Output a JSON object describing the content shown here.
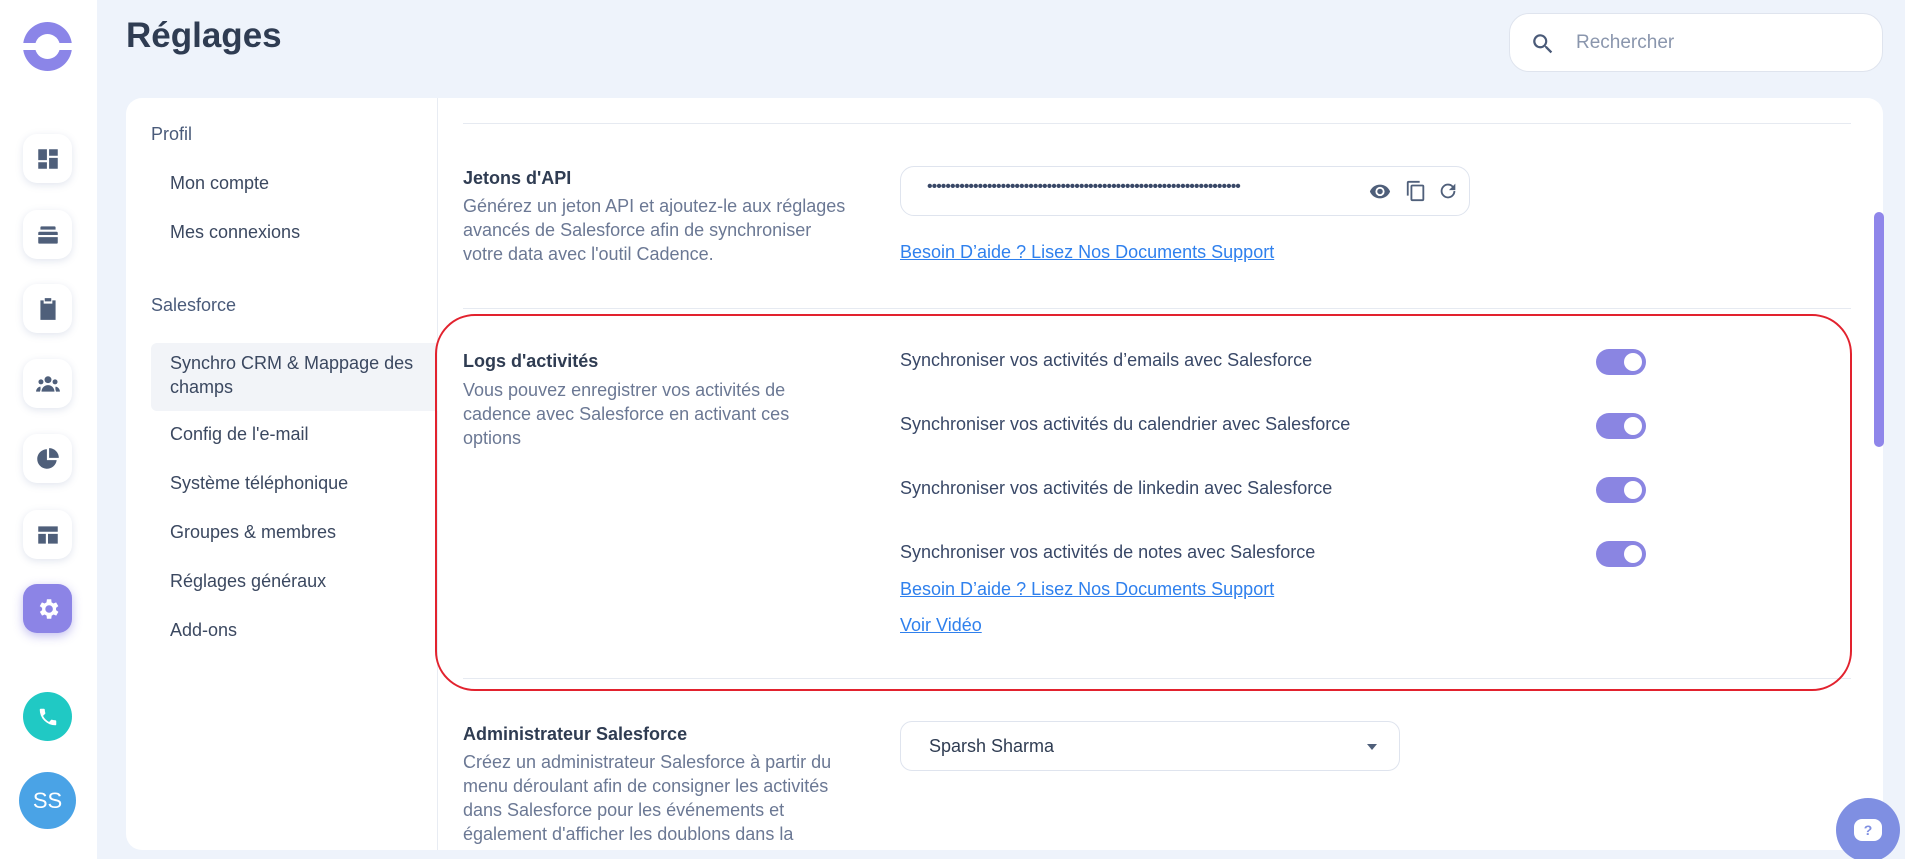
{
  "header": {
    "title": "Réglages",
    "search_placeholder": "Rechercher"
  },
  "rail": {
    "items": [
      {
        "name": "dashboard-icon"
      },
      {
        "name": "layers-icon"
      },
      {
        "name": "clipboard-icon"
      },
      {
        "name": "people-icon"
      },
      {
        "name": "pie-chart-icon"
      },
      {
        "name": "layout-icon"
      },
      {
        "name": "gear-icon",
        "active": true
      }
    ],
    "avatar_initials": "SS"
  },
  "sidebar": {
    "sections": [
      {
        "label": "Profil",
        "items": [
          "Mon compte",
          "Mes connexions"
        ]
      },
      {
        "label": "Salesforce",
        "items": [
          "Synchro CRM & Mappage des champs",
          "Config de l'e-mail",
          "Système téléphonique",
          "Groupes & membres",
          "Réglages généraux",
          "Add-ons"
        ]
      }
    ]
  },
  "api_tokens": {
    "title": "Jetons d'API",
    "description": "Générez un jeton API et ajoutez-le aux réglages avancés de Salesforce afin de synchroniser votre data avec l'outil Cadence.",
    "masked_value": "••••••••••••••••••••••••••••••••••••••••••••••••••••••••••••••••••••",
    "help_link": "Besoin D’aide ? Lisez Nos Documents Support"
  },
  "activity_logs": {
    "title": "Logs d'activités",
    "description": "Vous pouvez enregistrer vos activités de cadence avec Salesforce en activant ces options",
    "options": [
      {
        "label": "Synchroniser vos activités d’emails avec Salesforce",
        "enabled": true
      },
      {
        "label": "Synchroniser vos activités du calendrier avec Salesforce",
        "enabled": true
      },
      {
        "label": "Synchroniser vos activités de linkedin avec Salesforce",
        "enabled": true
      },
      {
        "label": "Synchroniser vos activités de notes avec Salesforce",
        "enabled": true
      }
    ],
    "help_link": "Besoin D’aide ? Lisez Nos Documents Support",
    "video_link": "Voir Vidéo"
  },
  "admin": {
    "title": "Administrateur Salesforce",
    "description": "Créez un administrateur Salesforce à partir du menu déroulant afin de consigner les activités dans Salesforce pour les événements et également d'afficher les doublons dans la",
    "selected": "Sparsh Sharma"
  },
  "colors": {
    "accent": "#8c84e6",
    "link": "#2f80ed",
    "highlight": "#e2222e",
    "phone": "#20c9c4"
  }
}
